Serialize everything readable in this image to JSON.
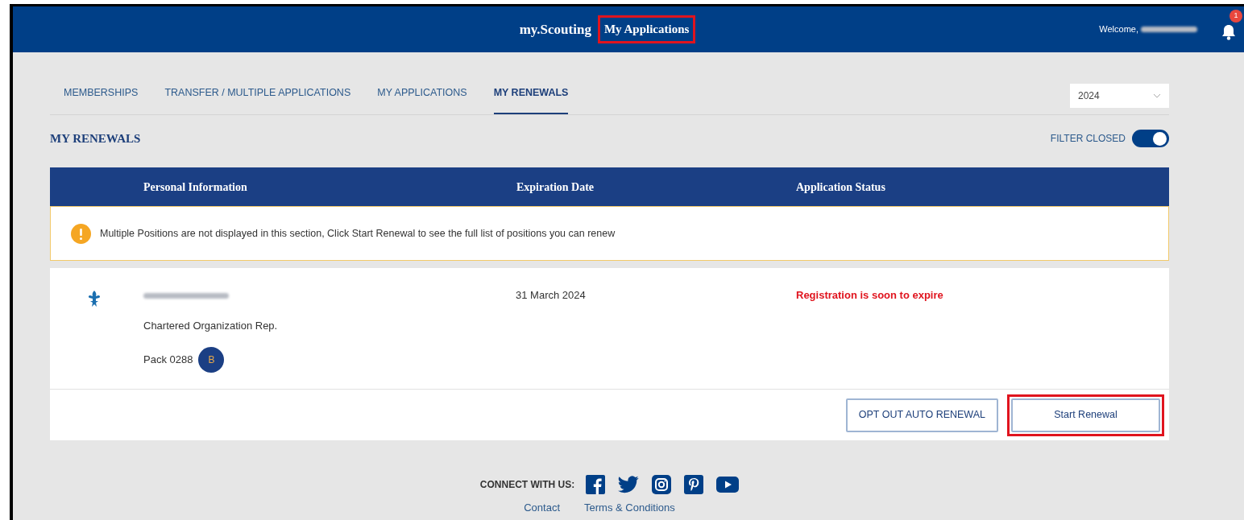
{
  "header": {
    "brand": "my.Scouting",
    "page_title": "My Applications",
    "page_title_highlighted": true,
    "welcome": "Welcome,",
    "notification_count": "1"
  },
  "tabs": [
    {
      "label": "MEMBERSHIPS",
      "selected": false
    },
    {
      "label": "TRANSFER / MULTIPLE APPLICATIONS",
      "selected": false
    },
    {
      "label": "MY APPLICATIONS",
      "selected": false
    },
    {
      "label": "MY RENEWALS",
      "selected": true
    }
  ],
  "year_select": {
    "value": "2024"
  },
  "section_title": "MY RENEWALS",
  "filter": {
    "label": "FILTER CLOSED",
    "on": true
  },
  "table": {
    "columns": [
      "Personal Information",
      "Expiration Date",
      "Application Status"
    ],
    "notice": "Multiple Positions are not displayed in this section, Click Start Renewal to see the full list of positions you can renew",
    "rows": [
      {
        "position": "Chartered Organization Rep.",
        "unit": "Pack 0288",
        "unit_badge": "B",
        "expiration": "31 March 2024",
        "status": "Registration is soon to expire"
      }
    ]
  },
  "actions": [
    {
      "label": "OPT OUT AUTO RENEWAL",
      "highlighted": false
    },
    {
      "label": "Start Renewal",
      "highlighted": true
    }
  ],
  "footer": {
    "connect": "CONNECT WITH US:",
    "links": [
      "Contact",
      "Terms & Conditions"
    ]
  }
}
